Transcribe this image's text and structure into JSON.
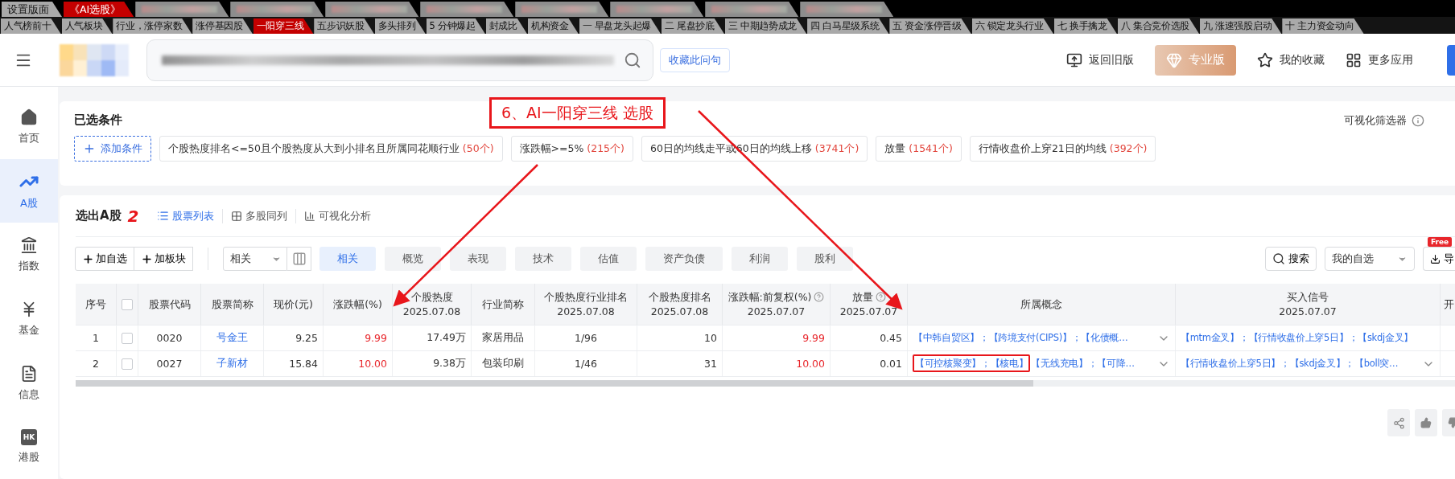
{
  "top_tabs": [
    {
      "kind": "tab",
      "label": "设置版面",
      "selected": false
    },
    {
      "kind": "tab",
      "label": "《AI选股》",
      "selected": true
    },
    {
      "kind": "blurred",
      "selected": false
    },
    {
      "kind": "blurred",
      "selected": false
    },
    {
      "kind": "blurred",
      "selected": false
    },
    {
      "kind": "blurred",
      "selected": false
    },
    {
      "kind": "blurred",
      "selected": false
    },
    {
      "kind": "blurred",
      "selected": false
    },
    {
      "kind": "blurred",
      "selected": false
    },
    {
      "kind": "blurred",
      "selected": false
    }
  ],
  "strategy_tabs": [
    {
      "label": "人气榜前十",
      "selected": false
    },
    {
      "label": "人气板块",
      "selected": false
    },
    {
      "label": "行业，涨停家数",
      "selected": false
    },
    {
      "label": "涨停基因股",
      "selected": false
    },
    {
      "label": "一阳穿三线",
      "selected": true
    },
    {
      "label": "五步识妖股",
      "selected": false
    },
    {
      "label": "多头排列",
      "selected": false
    },
    {
      "label": "5 分钟爆起",
      "selected": false
    },
    {
      "label": "封成比",
      "selected": false
    },
    {
      "label": "机构资金",
      "selected": false
    },
    {
      "label": "一 早盘龙头起爆",
      "selected": false
    },
    {
      "label": "二 尾盘抄底",
      "selected": false
    },
    {
      "label": "三 中期趋势成龙",
      "selected": false
    },
    {
      "label": "四  白马星级系统",
      "selected": false
    },
    {
      "label": "五 资金涨停晋级",
      "selected": false
    },
    {
      "label": "六 锁定龙头行业",
      "selected": false
    },
    {
      "label": "七 换手擒龙",
      "selected": false
    },
    {
      "label": "八 集合竞价选股",
      "selected": false
    },
    {
      "label": "九 涨速强股启动",
      "selected": false
    },
    {
      "label": "十 主力资金动向",
      "selected": false
    }
  ],
  "header": {
    "bookmark_button": "收藏此问句",
    "links": [
      {
        "kind": "back",
        "label": "返回旧版"
      },
      {
        "kind": "pro",
        "label": "专业版"
      },
      {
        "kind": "favorite",
        "label": "我的收藏"
      },
      {
        "kind": "apps",
        "label": "更多应用"
      }
    ]
  },
  "sidebar": [
    {
      "kind": "home",
      "label": "首页",
      "selected": false
    },
    {
      "kind": "stock",
      "label": "A股",
      "selected": true
    },
    {
      "kind": "index",
      "label": "指数",
      "selected": false
    },
    {
      "kind": "fund",
      "label": "基金",
      "selected": false
    },
    {
      "kind": "news",
      "label": "信息",
      "selected": false
    },
    {
      "kind": "hk",
      "label": "港股",
      "badge": "HK",
      "selected": false
    }
  ],
  "conditions": {
    "title": "已选条件",
    "visual_filter": "可视化筛选器",
    "add_button": "添加条件",
    "chips": [
      {
        "text": "个股热度排名<=50且个股热度从大到小排名且所属同花顺行业",
        "count": "(50个)"
      },
      {
        "text": "涨跌幅>=5%",
        "count": "(215个)"
      },
      {
        "text": "60日的均线走平或60日的均线上移",
        "count": "(3741个)"
      },
      {
        "text": "放量",
        "count": "(1541个)"
      },
      {
        "text": "行情收盘价上穿21日的均线",
        "count": "(392个)"
      }
    ]
  },
  "annotation": {
    "title": "6、AI一阳穿三线 选股",
    "count_mark": "2"
  },
  "results": {
    "title": "选出A股",
    "views": [
      {
        "kind": "list",
        "label": "股票列表",
        "selected": true
      },
      {
        "kind": "grid",
        "label": "多股同列",
        "selected": false
      },
      {
        "kind": "chart",
        "label": "可视化分析",
        "selected": false
      }
    ],
    "actions": [
      "加自选",
      "加板块"
    ],
    "sort_select": "相关",
    "categories": [
      {
        "label": "相关",
        "selected": true
      },
      {
        "label": "概览",
        "selected": false
      },
      {
        "label": "表现",
        "selected": false
      },
      {
        "label": "技术",
        "selected": false
      },
      {
        "label": "估值",
        "selected": false
      },
      {
        "label": "资产负债",
        "selected": false
      },
      {
        "label": "利润",
        "selected": false
      },
      {
        "label": "股利",
        "selected": false
      }
    ],
    "search_button": "搜索",
    "watchlist_select": "我的自选",
    "export": {
      "label": "导",
      "badge": "Free"
    },
    "table": {
      "columns": [
        {
          "kind": "index",
          "label": "序号"
        },
        {
          "kind": "check",
          "checked": false
        },
        {
          "kind": "code",
          "label": "股票代码"
        },
        {
          "kind": "name",
          "label": "股票简称"
        },
        {
          "kind": "price",
          "label": "现价(元)"
        },
        {
          "kind": "change",
          "label": "涨跌幅(%)"
        },
        {
          "kind": "heat",
          "label": "个股热度",
          "date": "2025.07.08"
        },
        {
          "kind": "industry",
          "label": "行业简称"
        },
        {
          "kind": "industry_rank",
          "label": "个股热度行业排名",
          "date": "2025.07.08"
        },
        {
          "kind": "heat_rank",
          "label": "个股热度排名",
          "date": "2025.07.08"
        },
        {
          "kind": "change_adj",
          "label": "涨跌幅:前复权(%)",
          "date": "2025.07.07",
          "help": true
        },
        {
          "kind": "volume",
          "label": "放量",
          "date": "2025.07.07",
          "help": true
        },
        {
          "kind": "concepts",
          "label": "所属概念"
        },
        {
          "kind": "signals",
          "label": "买入信号",
          "date": "2025.07.07"
        },
        {
          "kind": "open",
          "label": "开"
        }
      ],
      "rows": [
        {
          "index": "1",
          "checked": false,
          "code": "0020",
          "name": "号金王",
          "price": "9.25",
          "change": "9.99",
          "heat": "17.49万",
          "industry": "家居用品",
          "industry_rank": "1/96",
          "heat_rank": "10",
          "change_adj": "9.99",
          "volume": "0.45",
          "concepts": [
            {
              "text": "【中韩自贸区】；【跨境支付(CIPS)】；【化债概…",
              "annotated": false
            }
          ],
          "concepts_expandable": true,
          "signals": "【mtm金叉】；【行情收盘价上穿5日】；【skdj金叉】",
          "signals_expandable": false
        },
        {
          "index": "2",
          "checked": false,
          "code": "0027",
          "name": "子新材",
          "price": "15.84",
          "change": "10.00",
          "heat": "9.38万",
          "industry": "包装印刷",
          "industry_rank": "1/46",
          "heat_rank": "31",
          "change_adj": "10.00",
          "volume": "0.01",
          "concepts": [
            {
              "text": "【可控核聚变】；【核电】",
              "annotated": true
            },
            {
              "text": "【无线充电】；【可降…",
              "annotated": false
            }
          ],
          "concepts_expandable": true,
          "signals": "【行情收盘价上穿5日】；【skdj金叉】；【boll突…",
          "signals_expandable": true
        }
      ]
    }
  }
}
